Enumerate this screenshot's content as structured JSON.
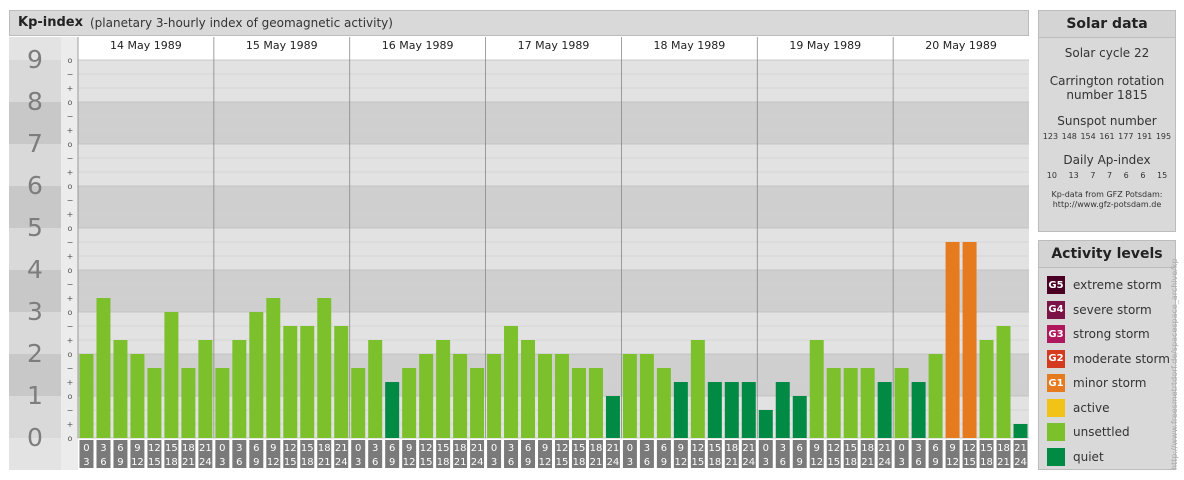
{
  "header": {
    "title": "Kp-index",
    "subtitle": "(planetary 3-hourly index of geomagnetic activity)"
  },
  "chart_data": {
    "type": "bar",
    "y_ticks": [
      "0",
      "1",
      "2",
      "3",
      "4",
      "5",
      "6",
      "7",
      "8",
      "9"
    ],
    "y_minor_labels": [
      "o",
      "+",
      "−"
    ],
    "ylim": [
      0,
      9
    ],
    "days": [
      "14 May 1989",
      "15 May 1989",
      "16 May 1989",
      "17 May 1989",
      "18 May 1989",
      "19 May 1989",
      "20 May 1989"
    ],
    "intervals": [
      [
        "0",
        "3"
      ],
      [
        "3",
        "6"
      ],
      [
        "6",
        "9"
      ],
      [
        "9",
        "12"
      ],
      [
        "12",
        "15"
      ],
      [
        "15",
        "18"
      ],
      [
        "18",
        "21"
      ],
      [
        "21",
        "24"
      ]
    ],
    "values": [
      [
        2.0,
        3.333,
        2.333,
        2.0,
        1.667,
        3.0,
        1.667,
        2.333
      ],
      [
        1.667,
        2.333,
        3.0,
        3.333,
        2.667,
        2.667,
        3.333,
        2.667
      ],
      [
        1.667,
        2.333,
        1.333,
        1.667,
        2.0,
        2.333,
        2.0,
        1.667
      ],
      [
        2.0,
        2.667,
        2.333,
        2.0,
        2.0,
        1.667,
        1.667,
        1.0
      ],
      [
        2.0,
        2.0,
        1.667,
        1.333,
        2.333,
        1.333,
        1.333,
        1.333
      ],
      [
        0.667,
        1.333,
        1.0,
        2.333,
        1.667,
        1.667,
        1.667,
        1.333
      ],
      [
        1.667,
        1.333,
        2.0,
        4.667,
        4.667,
        2.333,
        2.667,
        0.333
      ]
    ],
    "grid": true,
    "legend": "right"
  },
  "solar": {
    "title": "Solar data",
    "cycle": "Solar cycle 22",
    "carrington_line1": "Carrington rotation",
    "carrington_line2": "number 1815",
    "sunspot_title": "Sunspot number",
    "sunspot_values": [
      "123",
      "148",
      "154",
      "161",
      "177",
      "191",
      "195"
    ],
    "ap_title": "Daily Ap-index",
    "ap_values": [
      "10",
      "13",
      "7",
      "7",
      "6",
      "6",
      "15"
    ],
    "credit_line1": "Kp-data from GFZ Potsdam:",
    "credit_line2": "http://www.gfz-potsdam.de"
  },
  "levels": {
    "title": "Activity levels",
    "items": [
      {
        "code": "G5",
        "label": "extreme storm",
        "color": "#4a0023"
      },
      {
        "code": "G4",
        "label": "severe storm",
        "color": "#7a1446"
      },
      {
        "code": "G3",
        "label": "strong storm",
        "color": "#b0185e"
      },
      {
        "code": "G2",
        "label": "moderate storm",
        "color": "#d33a1f"
      },
      {
        "code": "G1",
        "label": "minor storm",
        "color": "#e57a1e"
      },
      {
        "code": "",
        "label": "active",
        "color": "#f2c316"
      },
      {
        "code": "",
        "label": "unsettled",
        "color": "#7cc02c"
      },
      {
        "code": "",
        "label": "quiet",
        "color": "#008a44"
      }
    ]
  },
  "side_credit": "http://www.freesmetrtdorf.de/spacespace_archive/kp"
}
